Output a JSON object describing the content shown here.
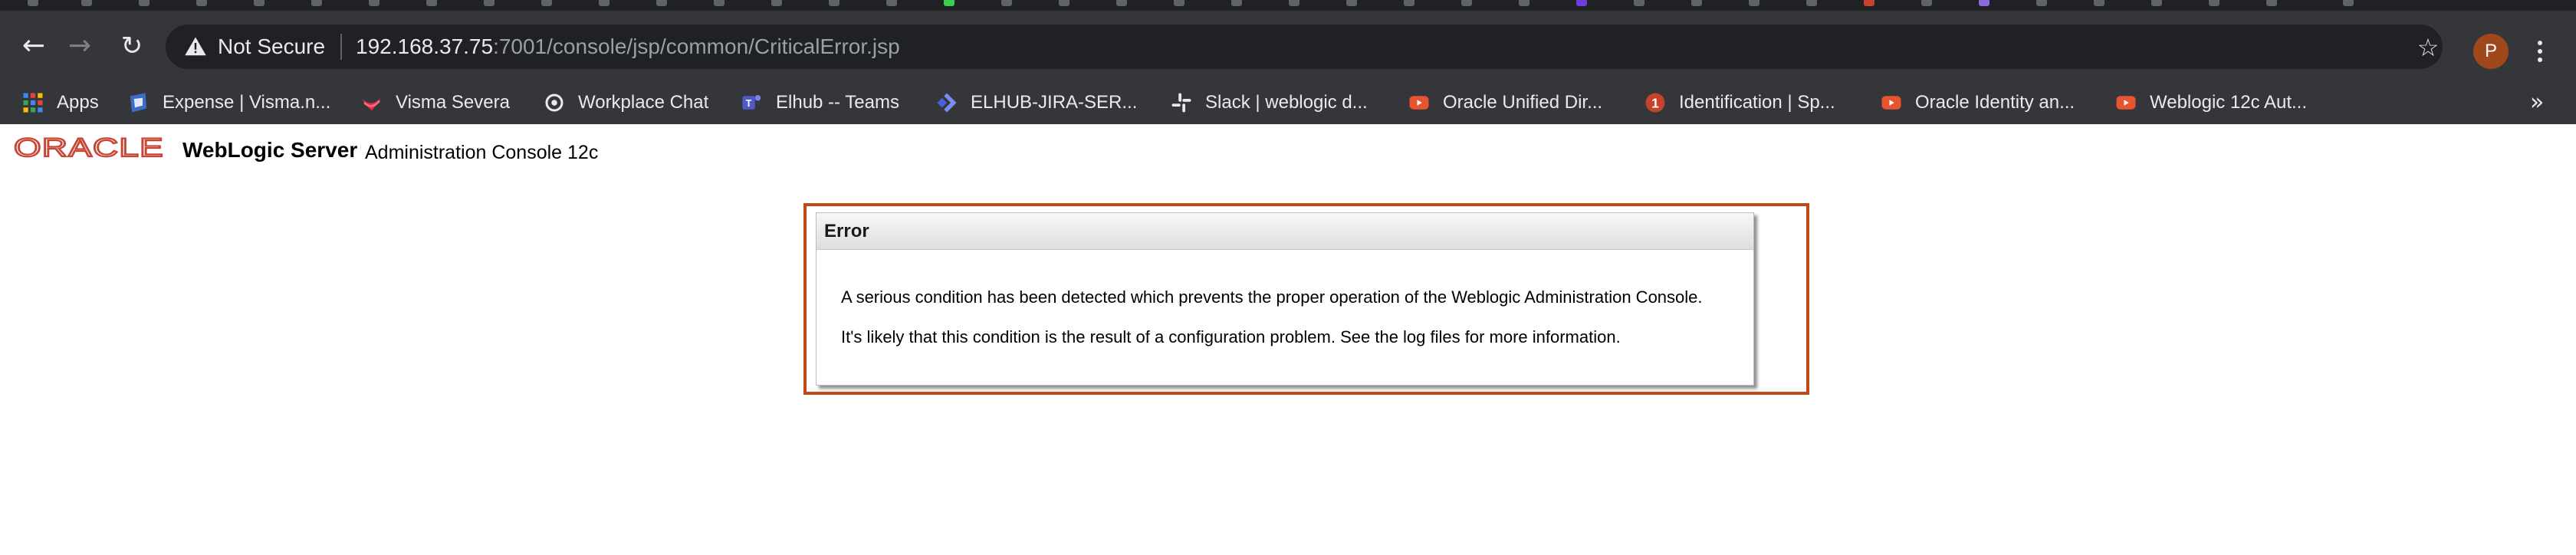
{
  "browser": {
    "address_bar": {
      "security_label": "Not Secure",
      "url_host": "192.168.37.75",
      "url_path": ":7001/console/jsp/common/CriticalError.jsp"
    },
    "profile_initial": "P",
    "bookmarks": [
      {
        "label": "Apps",
        "icon": "apps-grid-icon"
      },
      {
        "label": "Expense | Visma.n...",
        "icon": "visma-expense-icon"
      },
      {
        "label": "Visma Severa",
        "icon": "visma-severa-icon"
      },
      {
        "label": "Workplace Chat",
        "icon": "workplace-chat-icon"
      },
      {
        "label": "Elhub -- Teams",
        "icon": "teams-icon"
      },
      {
        "label": "ELHUB-JIRA-SER...",
        "icon": "jira-icon"
      },
      {
        "label": "Slack | weblogic d...",
        "icon": "slack-icon"
      },
      {
        "label": "Oracle Unified Dir...",
        "icon": "youtube-icon"
      },
      {
        "label": "Identification | Sp...",
        "icon": "identification-icon"
      },
      {
        "label": "Oracle Identity an...",
        "icon": "youtube-icon"
      },
      {
        "label": "Weblogic 12c Aut...",
        "icon": "youtube-icon"
      }
    ],
    "colors": {
      "chrome_dark": "#202124",
      "toolbar": "#35363a",
      "profile": "#a0481b"
    }
  },
  "page": {
    "brand": "ORACLE",
    "product_name": "WebLogic Server",
    "product_subtitle": "Administration Console 12c",
    "error": {
      "title": "Error",
      "messages": [
        "A serious condition has been detected which prevents the proper operation of the Weblogic Administration Console.",
        "It's likely that this condition is the result of a configuration problem. See the log files for more information."
      ]
    },
    "colors": {
      "oracle_red": "#c74634",
      "error_frame": "#bf4a17"
    }
  }
}
